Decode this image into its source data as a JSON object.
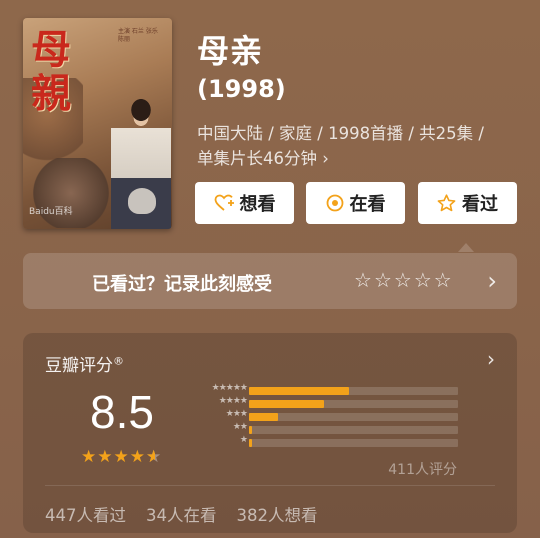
{
  "movie": {
    "title": "母亲",
    "year": "(1998)",
    "meta_line1": "中国大陆 / 家庭 / 1998首播 / 共25集 /",
    "meta_line2": "单集片长46分钟 ›",
    "poster": {
      "title_text": "母\n親",
      "credits_text": "主演 石兰 张乐 陈丽",
      "watermark": "Baidu百科"
    }
  },
  "actions": {
    "want": "想看",
    "watching": "在看",
    "watched": "看过"
  },
  "record": {
    "text": "已看过？记录此刻感受",
    "stars": [
      "☆",
      "☆",
      "☆",
      "☆",
      "☆"
    ]
  },
  "rating": {
    "label": "豆瓣评分",
    "reg_mark": "®",
    "score": "8.5",
    "stars_filled": 4,
    "stars_half": 1,
    "distribution": [
      {
        "label": "★★★★★",
        "fraction": 0.48
      },
      {
        "label": "★★★★",
        "fraction": 0.36
      },
      {
        "label": "★★★",
        "fraction": 0.14
      },
      {
        "label": "★★",
        "fraction": 0.012
      },
      {
        "label": "★",
        "fraction": 0.012
      }
    ],
    "count_text": "411人评分",
    "stats": [
      "447人看过",
      "34人在看",
      "382人想看"
    ]
  },
  "colors": {
    "background": "#8a6549",
    "accent": "#f3a21a"
  }
}
